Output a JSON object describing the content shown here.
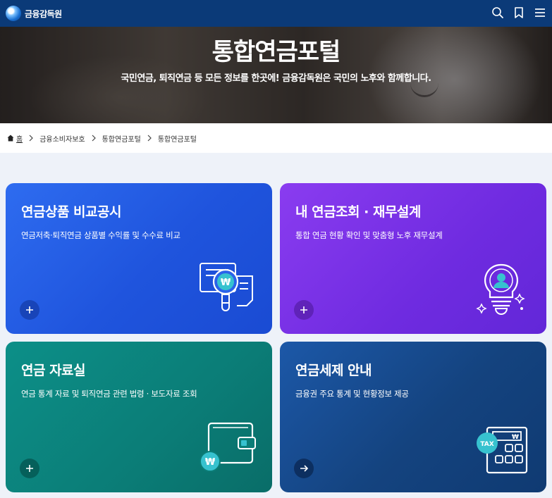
{
  "header": {
    "logo_text": "금융감독원",
    "icons": [
      "search-icon",
      "bookmark-icon",
      "menu-icon"
    ]
  },
  "hero": {
    "title": "통합연금포털",
    "subtitle": "국민연금, 퇴직연금 등 모든 정보를 한곳에! 금융감독원은 국민의 노후와 함께합니다."
  },
  "breadcrumb": {
    "home": "홈",
    "items": [
      "금융소비자보호",
      "통합연금포털",
      "통합연금포털"
    ]
  },
  "cards": [
    {
      "title": "연금상품 비교공시",
      "description": "연금저축·퇴직연금 상품별 수익률 및 수수료 비교",
      "action_icon": "plus-icon",
      "illustration": "document-magnifier-won-icon",
      "color": "#2a63ea"
    },
    {
      "title": "내 연금조회 · 재무설계",
      "description": "통합 연금 현황 확인 및 맞춤형 노후 재무설계",
      "action_icon": "plus-icon",
      "illustration": "lightbulb-person-icon",
      "color": "#7a33e6"
    },
    {
      "title": "연금 자료실",
      "description": "연금 통계 자료 및 퇴직연금 관련 법령 · 보도자료 조회",
      "action_icon": "plus-icon",
      "illustration": "wallet-won-icon",
      "color": "#0b8781"
    },
    {
      "title": "연금세제 안내",
      "description": "금융권 주요 통계 및 현황정보 제공",
      "action_icon": "arrow-right-icon",
      "illustration": "calculator-tax-icon",
      "color": "#174c92",
      "illus_labels": {
        "tax": "TAX",
        "won": "₩"
      }
    }
  ],
  "won_symbol": "₩"
}
